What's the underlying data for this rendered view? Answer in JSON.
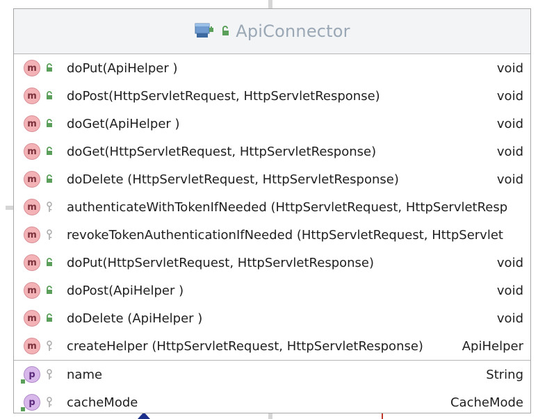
{
  "class_box": {
    "name": "ApiConnector",
    "class_icon": "class-icon",
    "visibility_icon": "public-icon"
  },
  "methods": [
    {
      "badge": "m",
      "visibility": "public",
      "signature": "doPut(ApiHelper )",
      "type": "void"
    },
    {
      "badge": "m",
      "visibility": "public",
      "signature": "doPost(HttpServletRequest, HttpServletResponse)",
      "type": "void"
    },
    {
      "badge": "m",
      "visibility": "public",
      "signature": "doGet(ApiHelper )",
      "type": "void"
    },
    {
      "badge": "m",
      "visibility": "public",
      "signature": "doGet(HttpServletRequest, HttpServletResponse)",
      "type": "void"
    },
    {
      "badge": "m",
      "visibility": "public",
      "signature": "doDelete (HttpServletRequest, HttpServletResponse)",
      "type": "void"
    },
    {
      "badge": "m",
      "visibility": "private",
      "signature": "authenticateWithTokenIfNeeded (HttpServletRequest, HttpServletResp",
      "type": ""
    },
    {
      "badge": "m",
      "visibility": "private",
      "signature": "revokeTokenAuthenticationIfNeeded (HttpServletRequest, HttpServlet",
      "type": ""
    },
    {
      "badge": "m",
      "visibility": "public",
      "signature": "doPut(HttpServletRequest, HttpServletResponse)",
      "type": "void"
    },
    {
      "badge": "m",
      "visibility": "public",
      "signature": "doPost(ApiHelper )",
      "type": "void"
    },
    {
      "badge": "m",
      "visibility": "public",
      "signature": "doDelete (ApiHelper )",
      "type": "void"
    },
    {
      "badge": "m",
      "visibility": "private",
      "signature": "createHelper (HttpServletRequest, HttpServletResponse)",
      "type": "ApiHelper"
    }
  ],
  "fields": [
    {
      "badge": "p",
      "visibility": "private",
      "signature": "name",
      "type": "String"
    },
    {
      "badge": "p",
      "visibility": "private",
      "signature": "cacheMode",
      "type": "CacheMode"
    }
  ],
  "colors": {
    "method_badge": "#f2b2b6",
    "property_badge": "#d8b7ea",
    "public_icon": "#5aa05a",
    "private_icon": "#a8a8a8",
    "title": "#9aa7b5"
  }
}
